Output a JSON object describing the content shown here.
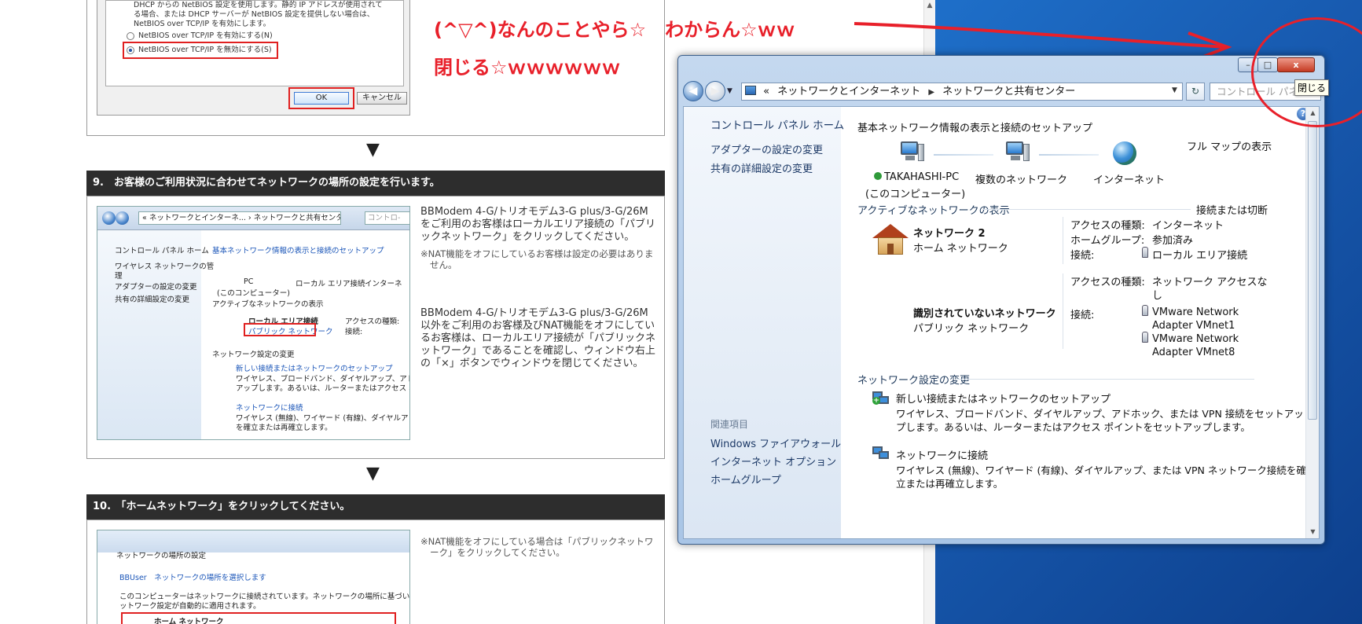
{
  "webpage": {
    "top_dialog": {
      "lines": [
        "DHCP からの NetBIOS 設定を使用します。静的 IP アドレスが使用されて",
        "る場合、または DHCP サーバーが NetBIOS 設定を提供しない場合は、",
        "NetBIOS over TCP/IP を有効にします。"
      ],
      "radio_enable": "NetBIOS over TCP/IP を有効にする(N)",
      "radio_disable": "NetBIOS over TCP/IP を無効にする(S)",
      "ok": "OK",
      "cancel": "キャンセル"
    },
    "step9": {
      "header": "9.　お客様のご利用状況に合わせてネットワークの場所の設定を行います。",
      "thumb": {
        "address": "« ネットワークとインターネ... › ネットワークと共有センター",
        "search": "コントロ-",
        "left_items": [
          "コントロール パネル ホーム",
          "ワイヤレス ネットワークの管",
          "理",
          "アダプターの設定の変更",
          "共有の詳細設定の変更"
        ],
        "basic_info": "基本ネットワーク情報の表示と接続のセットアップ",
        "pc_label": "PC",
        "pc_sub": "(このコンピューター)",
        "local_area": "ローカル エリア接続",
        "internet": "インターネ",
        "active_net": "アクティブなネットワークの表示",
        "conn_name": "ローカル エリア接続",
        "conn_type": "パブリック ネットワーク",
        "access_label": "アクセスの種類:",
        "conn_label": "接続:",
        "change_head": "ネットワーク設定の変更",
        "new_conn": "新しい接続またはネットワークのセットアップ",
        "new_conn_desc1": "ワイヤレス、ブロードバンド、ダイヤルアップ、アドホック、",
        "new_conn_desc2": "アップします。あるいは、ルーターまたはアクセス ポイント",
        "connect": "ネットワークに接続",
        "connect_desc1": "ワイヤレス (無線)、ワイヤード (有線)、ダイヤルアップ、ま",
        "connect_desc2": "を確立または再確立します。"
      },
      "text1": [
        "BBModem 4-G/トリオモデム3-G plus/3-G/26M",
        "をご利用のお客様はローカルエリア接続の「パブリ",
        "ックネットワーク」をクリックしてください。"
      ],
      "note1": [
        "※NAT機能をオフにしているお客様は設定の必要はありま",
        "せん。"
      ],
      "text2": [
        "BBModem 4-G/トリオモデム3-G plus/3-G/26M",
        "以外をご利用のお客様及びNAT機能をオフにしてい",
        "るお客様は、ローカルエリア接続が「パブリックネ",
        "ットワーク」であることを確認し、ウィンドウ右上",
        "の「×」ボタンでウィンドウを閉じてください。"
      ]
    },
    "step10": {
      "header": "10.　「ホームネットワーク」をクリックしてください。",
      "thumb": {
        "title": "ネットワークの場所の設定",
        "select": "BBUser　ネットワークの場所を選択します",
        "desc1": "このコンピューターはネットワークに接続されています。ネットワークの場所に基づいて、正しいネ",
        "desc2": "ットワーク設定が自動的に適用されます。",
        "home": "ホーム ネットワーク"
      },
      "note": [
        "※NAT機能をオフにしている場合は「パブリックネットワ",
        "ーク」をクリックしてください。"
      ]
    },
    "arrow": "▼"
  },
  "annotation": {
    "line1": "(^▽^)なんのことやら☆　わからん☆ｗｗ",
    "line2": "閉じる☆ｗｗｗｗｗｗ",
    "color": "#e8202a"
  },
  "window": {
    "tooltip": "閉じる",
    "minimize": "–",
    "maximize": "□",
    "close": "x",
    "back": "◀",
    "forward": "▶",
    "address": {
      "root": "«",
      "crumb1": "ネットワークとインターネット",
      "crumb2": "ネットワークと共有センター"
    },
    "search_placeholder": "コントロール パネル...",
    "left": {
      "home": "コントロール パネル ホーム",
      "adapter": "アダプターの設定の変更",
      "sharing": "共有の詳細設定の変更",
      "related": "関連項目",
      "firewall": "Windows ファイアウォール",
      "inet_opts": "インターネット オプション",
      "homegroup": "ホームグループ"
    },
    "main": {
      "basic_info": "基本ネットワーク情報の表示と接続のセットアップ",
      "full_map": "フル マップの表示",
      "node_pc": "TAKAHASHI-PC",
      "node_pc_sub": "(このコンピューター)",
      "node_multi": "複数のネットワーク",
      "node_inet": "インターネット",
      "active_head": "アクティブなネットワークの表示",
      "connect_disconnect": "接続または切断",
      "net1": {
        "name": "ネットワーク 2",
        "type": "ホーム ネットワーク",
        "access_label": "アクセスの種類:",
        "access_value": "インターネット",
        "homegroup_label": "ホームグループ:",
        "homegroup_value": "参加済み",
        "conn_label": "接続:",
        "conn_value": "ローカル エリア接続"
      },
      "net2": {
        "name": "識別されていないネットワーク",
        "type": "パブリック ネットワーク",
        "access_label": "アクセスの種類:",
        "access_value1": "ネットワーク アクセスな",
        "access_value2": "し",
        "conn_label": "接続:",
        "conn_a1": "VMware Network",
        "conn_a2": "Adapter VMnet1",
        "conn_b1": "VMware Network",
        "conn_b2": "Adapter VMnet8"
      },
      "change_head": "ネットワーク設定の変更",
      "new_conn": "新しい接続またはネットワークのセットアップ",
      "new_conn_desc1": "ワイヤレス、ブロードバンド、ダイヤルアップ、アドホック、または VPN 接続をセットアッ",
      "new_conn_desc2": "プします。あるいは、ルーターまたはアクセス ポイントをセットアップします。",
      "connect": "ネットワークに接続",
      "connect_desc1": "ワイヤレス (無線)、ワイヤード (有線)、ダイヤルアップ、または VPN ネットワーク接続を確",
      "connect_desc2": "立または再確立します。"
    }
  }
}
